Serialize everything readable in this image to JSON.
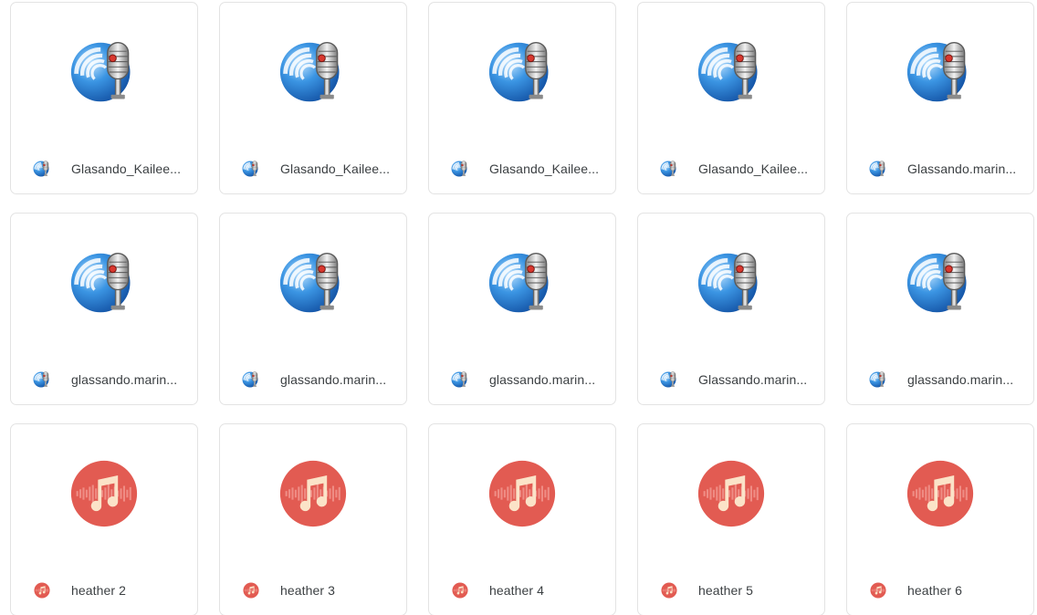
{
  "files": [
    {
      "name": "Glasando_Kailee...",
      "type": "microphone-audio-icon"
    },
    {
      "name": "Glasando_Kailee...",
      "type": "microphone-audio-icon"
    },
    {
      "name": "Glasando_Kailee...",
      "type": "microphone-audio-icon"
    },
    {
      "name": "Glasando_Kailee...",
      "type": "microphone-audio-icon"
    },
    {
      "name": "Glassando.marin...",
      "type": "microphone-audio-icon"
    },
    {
      "name": "glassando.marin...",
      "type": "microphone-audio-icon"
    },
    {
      "name": "glassando.marin...",
      "type": "microphone-audio-icon"
    },
    {
      "name": "glassando.marin...",
      "type": "microphone-audio-icon"
    },
    {
      "name": "Glassando.marin...",
      "type": "microphone-audio-icon"
    },
    {
      "name": "glassando.marin...",
      "type": "microphone-audio-icon"
    },
    {
      "name": "heather 2",
      "type": "music-note-icon"
    },
    {
      "name": "heather 3",
      "type": "music-note-icon"
    },
    {
      "name": "heather 4",
      "type": "music-note-icon"
    },
    {
      "name": "heather 5",
      "type": "music-note-icon"
    },
    {
      "name": "heather 6",
      "type": "music-note-icon"
    }
  ],
  "colors": {
    "card_border": "#e3e3e3",
    "text": "#3c4043",
    "mic_blue": "#2f7fd6",
    "music_red": "#e25b52"
  }
}
